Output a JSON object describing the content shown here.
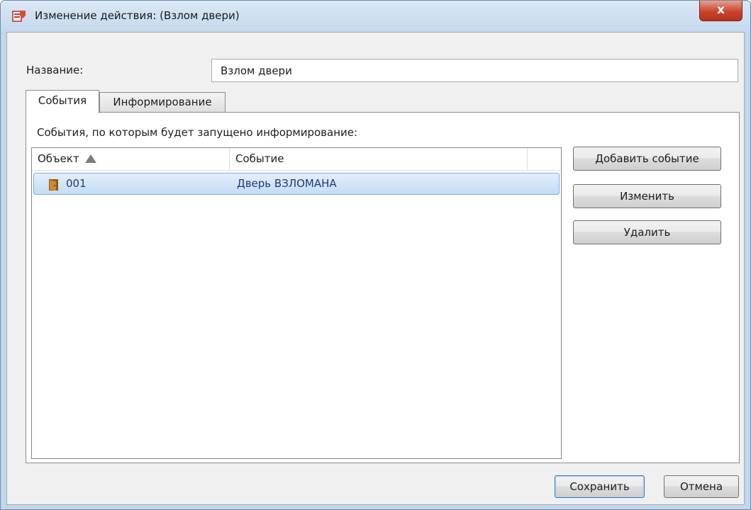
{
  "window": {
    "title": "Изменение действия: (Взлом двери)",
    "close_symbol": "x",
    "app_icon": "action-app-icon"
  },
  "form": {
    "name_label": "Название:",
    "name_value": "Взлом двери"
  },
  "tabs": [
    {
      "label": "События",
      "active": true
    },
    {
      "label": "Информирование",
      "active": false
    }
  ],
  "events_panel": {
    "caption": "События, по которым будет запущено информирование:",
    "columns": {
      "object": "Объект",
      "event": "Событие"
    },
    "rows": [
      {
        "icon": "door-icon",
        "object": "001",
        "event": "Дверь ВЗЛОМАНА",
        "selected": true
      }
    ],
    "buttons": {
      "add": "Добавить событие",
      "edit": "Изменить",
      "delete": "Удалить"
    }
  },
  "footer": {
    "save": "Сохранить",
    "cancel": "Отмена"
  },
  "colors": {
    "selection": "#c4dcf6",
    "close_button": "#c8442c",
    "row_text": "#1f3a7a"
  }
}
